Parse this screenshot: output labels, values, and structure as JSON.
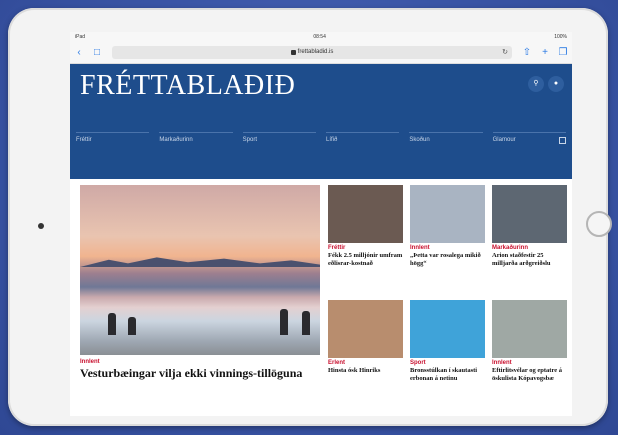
{
  "statusbar": {
    "left": "iPad",
    "time": "08:54",
    "battery": "100%"
  },
  "browser": {
    "url": "frettabladid.is"
  },
  "site": {
    "logo": "FRÉTTABLAÐIÐ",
    "nav": [
      "Fréttir",
      "Markaðurinn",
      "Sport",
      "Lífið",
      "Skoðun",
      "Glamour"
    ]
  },
  "hero": {
    "category": "Innlent",
    "headline": "Vesturbæingar vilja ekki vinnings-tillöguna"
  },
  "cards": [
    {
      "category": "Fréttir",
      "headline": "Fékk 2.5 milljónir umfram eðlisrar-kostnað",
      "thumb_color": "#6b5a52"
    },
    {
      "category": "Innlent",
      "headline": "„Þetta var rosalega mikið högg“",
      "thumb_color": "#a9b4c2"
    },
    {
      "category": "Markaðurinn",
      "headline": "Arion staðfestir 25 milljarða arðgreiðslu",
      "thumb_color": "#5d6772"
    },
    {
      "category": "Erlent",
      "headline": "Hinsta ósk Hinriks",
      "thumb_color": "#b88d6e"
    },
    {
      "category": "Sport",
      "headline": "Bronsstúlkan í skautasti erbonan á netinu",
      "thumb_color": "#3fa3d9"
    },
    {
      "category": "Innlent",
      "headline": "Eftirlitsvélar og eptatre á öskulista Kópavogsbæ",
      "thumb_color": "#9fa8a4"
    }
  ]
}
